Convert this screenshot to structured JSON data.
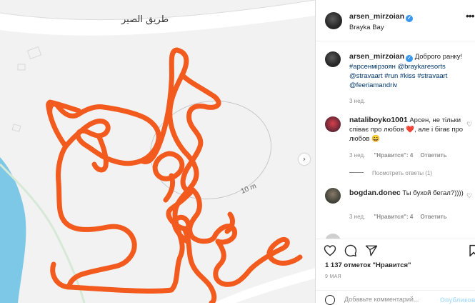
{
  "photo": {
    "road_label": "طريق الصير",
    "distance_label": "10 m",
    "colors": {
      "route": "#f35a1e",
      "water": "#7cc8e6",
      "map_bg": "#f2f2f2",
      "road": "#ffffff"
    }
  },
  "header": {
    "username": "arsen_mirzoian",
    "location": "Brayka Bay",
    "more_icon": "more-horizontal-icon"
  },
  "caption": {
    "username": "arsen_mirzoian",
    "text": "Доброго ранку!",
    "tags": [
      "#арсенмірзоян",
      "@braykaresorts",
      "@stravaart",
      "#run",
      "#kiss",
      "#stravaart",
      "@feeriamandriv"
    ],
    "time": "3 нед."
  },
  "comments": [
    {
      "username": "nataliboyko1001",
      "text": "Арсен, не тільки співає про любов ❤️, але і бігає про любов 😄",
      "time": "3 нед.",
      "likes": "\"Нравится\": 4",
      "reply": "Ответить",
      "view_replies": "Посмотреть ответы (1)"
    },
    {
      "username": "bogdan.donec",
      "text": "Ты бухой бегал?))))",
      "time": "3 нед.",
      "likes": "\"Нравится\": 4",
      "reply": "Ответить"
    }
  ],
  "actions": {
    "likes_text": "1 137 отметок \"Нравится\"",
    "date": "9 МАЯ"
  },
  "add_comment": {
    "placeholder": "Добавьте комментарий...",
    "publish": "Опубликовать"
  }
}
